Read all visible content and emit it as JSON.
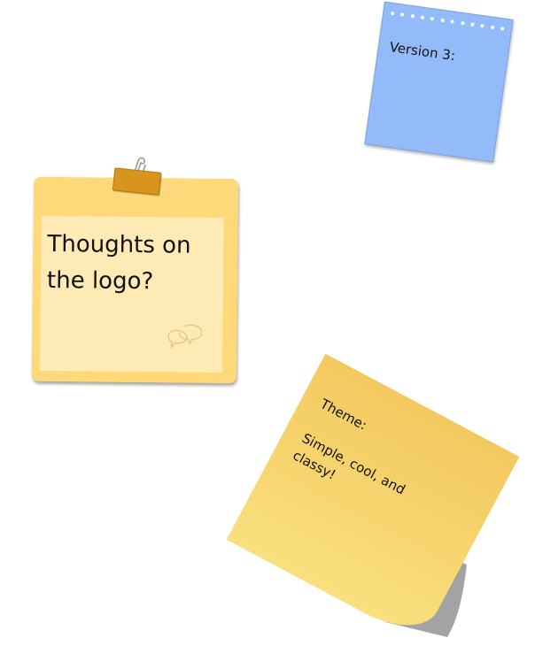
{
  "notes": {
    "blue": {
      "text": "Version 3:",
      "color": "#94bbf9"
    },
    "clip": {
      "text": "Thoughts on\nthe logo?",
      "color": "#fdd979",
      "inner_color": "#feeab5",
      "clip_color": "#d8941c",
      "icon": "chat-bubbles-icon"
    },
    "sticky": {
      "title": "Theme:",
      "body": "Simple, cool, and\nclassy!",
      "color": "#f6d36c"
    }
  }
}
